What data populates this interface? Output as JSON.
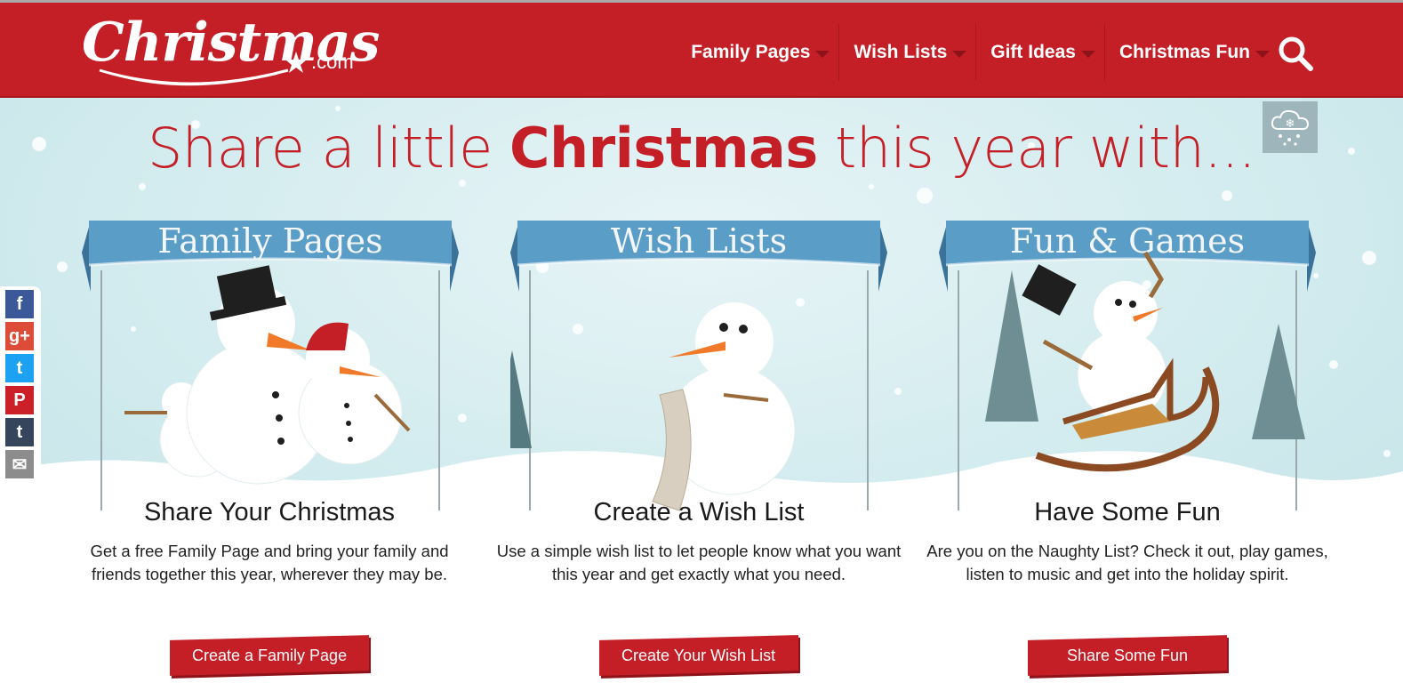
{
  "brand": {
    "logo_main": "Christmas",
    "logo_suffix": ".com"
  },
  "nav": {
    "items": [
      {
        "label": "Family Pages"
      },
      {
        "label": "Wish Lists"
      },
      {
        "label": "Gift Ideas"
      },
      {
        "label": "Christmas Fun"
      }
    ]
  },
  "hero": {
    "headline_pre": "Share a little ",
    "headline_bold": "Christmas",
    "headline_post": " this year with..."
  },
  "social": [
    "facebook-icon",
    "google-plus-icon",
    "twitter-icon",
    "pinterest-icon",
    "tumblr-icon",
    "email-icon"
  ],
  "cards": [
    {
      "banner": "Family Pages",
      "title": "Share Your Christmas",
      "body": "Get a free Family Page and bring your family and friends together this year, wherever they may be.",
      "button": "Create a Family Page"
    },
    {
      "banner": "Wish Lists",
      "title": "Create a Wish List",
      "body": "Use a simple wish list to let people know what you want this year and get exactly what you need.",
      "button": "Create Your Wish List"
    },
    {
      "banner": "Fun & Games",
      "title": "Have Some Fun",
      "body": "Are you on the Naughty List? Check it out, play games, listen to music and get into the holiday spirit.",
      "button": "Share Some Fun"
    }
  ],
  "colors": {
    "brand_red": "#c41e26",
    "banner_blue": "#4e93bb",
    "sky": "#d3ecef"
  }
}
